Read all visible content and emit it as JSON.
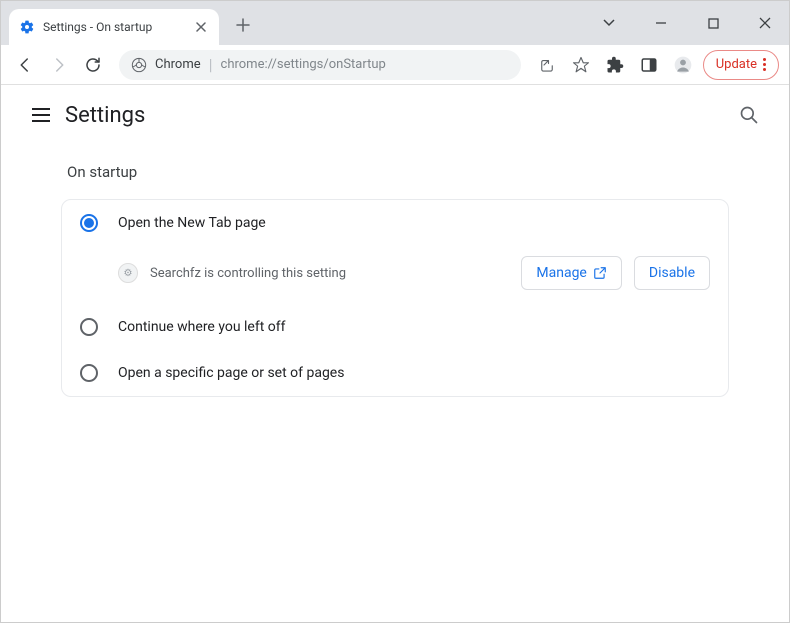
{
  "window": {
    "tab_title": "Settings - On startup"
  },
  "toolbar": {
    "chrome_label": "Chrome",
    "url": "chrome://settings/onStartup",
    "update_label": "Update"
  },
  "header": {
    "title": "Settings"
  },
  "section": {
    "title": "On startup",
    "options": [
      {
        "label": "Open the New Tab page",
        "checked": true
      },
      {
        "label": "Continue where you left off",
        "checked": false
      },
      {
        "label": "Open a specific page or set of pages",
        "checked": false
      }
    ],
    "controlled": {
      "extension_name": "Searchfz",
      "text": "Searchfz is controlling this setting",
      "manage_label": "Manage",
      "disable_label": "Disable"
    }
  },
  "colors": {
    "accent": "#1a73e8",
    "danger": "#d93025"
  }
}
